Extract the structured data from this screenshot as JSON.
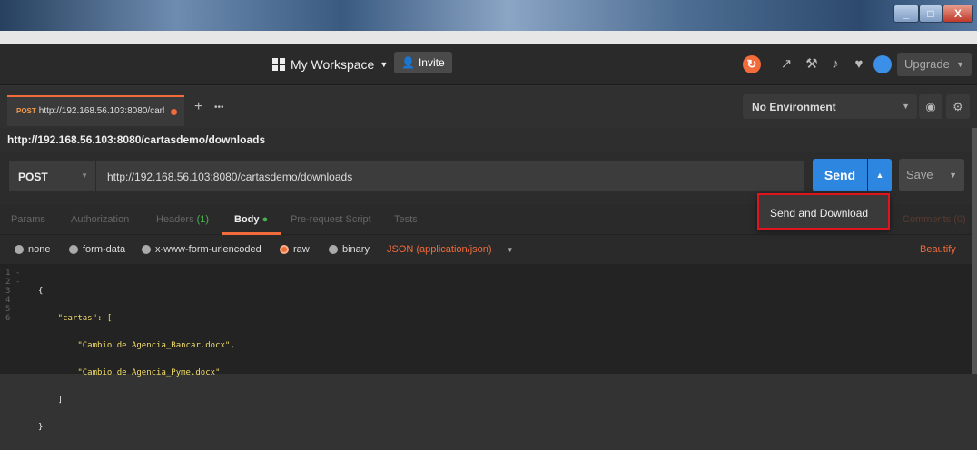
{
  "window": {
    "min": "_",
    "max": "□",
    "close": "X"
  },
  "appbar": {
    "workspace": "My Workspace",
    "workspace_caret": "▼",
    "invite": "Invite",
    "upgrade": "Upgrade",
    "upgrade_caret": "▼"
  },
  "tabs": {
    "active_method": "POST",
    "active_url": "http://192.168.56.103:8080/carl",
    "plus": "+",
    "more": "•••"
  },
  "environment": {
    "selected": "No Environment",
    "caret": "▼"
  },
  "request": {
    "title": "http://192.168.56.103:8080/cartasdemo/downloads",
    "method": "POST",
    "method_caret": "▼",
    "url": "http://192.168.56.103:8080/cartasdemo/downloads",
    "send": "Send",
    "send_caret": "▲",
    "save": "Save",
    "save_caret": "▼"
  },
  "subtabs": [
    {
      "label": "Params"
    },
    {
      "label": "Authorization"
    },
    {
      "label": "Headers",
      "count": "(1)"
    },
    {
      "label": "Body"
    },
    {
      "label": "Pre-request Script"
    },
    {
      "label": "Tests"
    }
  ],
  "comments": "Comments (0)",
  "body_options": {
    "none": "none",
    "form_data": "form-data",
    "urlencoded": "x-www-form-urlencoded",
    "raw": "raw",
    "binary": "binary",
    "content_type": "JSON (application/json)",
    "content_caret": "▼",
    "beautify": "Beautify"
  },
  "editor": {
    "line_numbers": [
      "1 -",
      "2 -",
      "3",
      "4",
      "5",
      "6"
    ],
    "lines": [
      "{",
      "    \"cartas\": [",
      "        \"Cambio de Agencia_Bancar.docx\",",
      "        \"Cambio de Agencia_Pyme.docx\"",
      "    ]",
      "}"
    ]
  },
  "dropdown": {
    "send_and_download": "Send and Download"
  },
  "colors": {
    "accent": "#f26b3a",
    "send_blue": "#2d86e0",
    "highlight_red": "#e0141e"
  },
  "icons": [
    "grid-icon",
    "invite-person-icon",
    "sync-icon",
    "satellite-icon",
    "wrench-icon",
    "bell-icon",
    "heart-icon",
    "avatar-icon",
    "eye-icon",
    "gear-icon"
  ]
}
